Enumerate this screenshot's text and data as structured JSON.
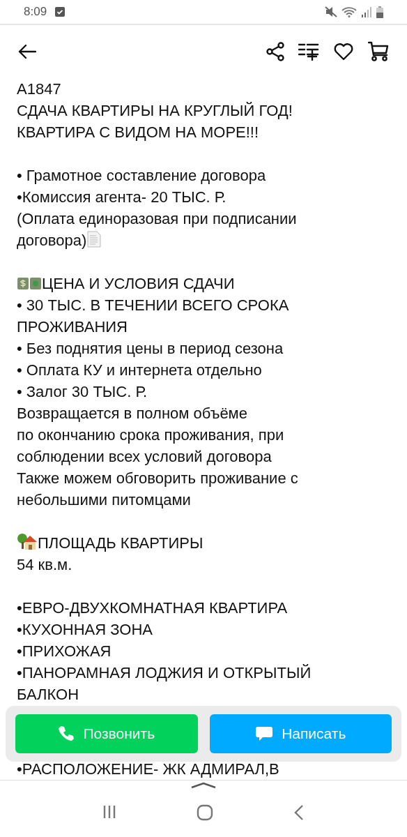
{
  "status_bar": {
    "time": "8:09"
  },
  "description": [
    {
      "kind": "text",
      "text": "A1847"
    },
    {
      "kind": "text",
      "text": "СДАЧА КВАРТИРЫ НА КРУГЛЫЙ ГОД!"
    },
    {
      "kind": "text",
      "text": "КВАРТИРА С ВИДОМ НА МОРЕ!!!"
    },
    {
      "kind": "gap"
    },
    {
      "kind": "text",
      "text": "• Грамотное составление договора"
    },
    {
      "kind": "text",
      "text": "•Комиссия агента- 20 ТЫС. Р."
    },
    {
      "kind": "text",
      "text": "(Оплата единоразовая при подписании"
    },
    {
      "kind": "document_line",
      "text": "договора)"
    },
    {
      "kind": "gap"
    },
    {
      "kind": "money_line",
      "text": "ЦЕНА И УСЛОВИЯ СДАЧИ"
    },
    {
      "kind": "text",
      "text": "• 30 ТЫС. В ТЕЧЕНИИ ВСЕГО СРОКА ПРОЖИВАНИЯ"
    },
    {
      "kind": "text",
      "text": "• Без поднятия цены в период сезона"
    },
    {
      "kind": "text",
      "text": "• Оплата КУ и интернета отдельно"
    },
    {
      "kind": "text",
      "text": "• Залог 30 ТЫС. Р."
    },
    {
      "kind": "text",
      "text": "Возвращается в полном объёме"
    },
    {
      "kind": "text",
      "text": "по окончанию срока проживания, при"
    },
    {
      "kind": "text",
      "text": "соблюдении всех условий договора"
    },
    {
      "kind": "text",
      "text": "Также можем обговорить проживание с"
    },
    {
      "kind": "text",
      "text": "небольшими питомцами"
    },
    {
      "kind": "gap"
    },
    {
      "kind": "house_line",
      "text": "ПЛОЩАДЬ КВАРТИРЫ"
    },
    {
      "kind": "text",
      "text": "54 кв.м."
    },
    {
      "kind": "gap"
    },
    {
      "kind": "text",
      "text": "•ЕВРО-ДВУХКОМНАТНАЯ КВАРТИРА"
    },
    {
      "kind": "text",
      "text": "•КУХОННАЯ ЗОНА"
    },
    {
      "kind": "text",
      "text": "•ПРИХОЖАЯ"
    },
    {
      "kind": "text",
      "text": "•ПАНОРАМНАЯ ЛОДЖИЯ И ОТКРЫТЫЙ БАЛКОН"
    },
    {
      "kind": "gap"
    },
    {
      "kind": "gap"
    },
    {
      "kind": "text",
      "text": "•РАСПОЛОЖЕНИЕ- ЖК АДМИРАЛ,В"
    }
  ],
  "actions": [
    {
      "kind": "call",
      "label": "Позвонить"
    },
    {
      "kind": "message",
      "label": "Написать"
    }
  ]
}
